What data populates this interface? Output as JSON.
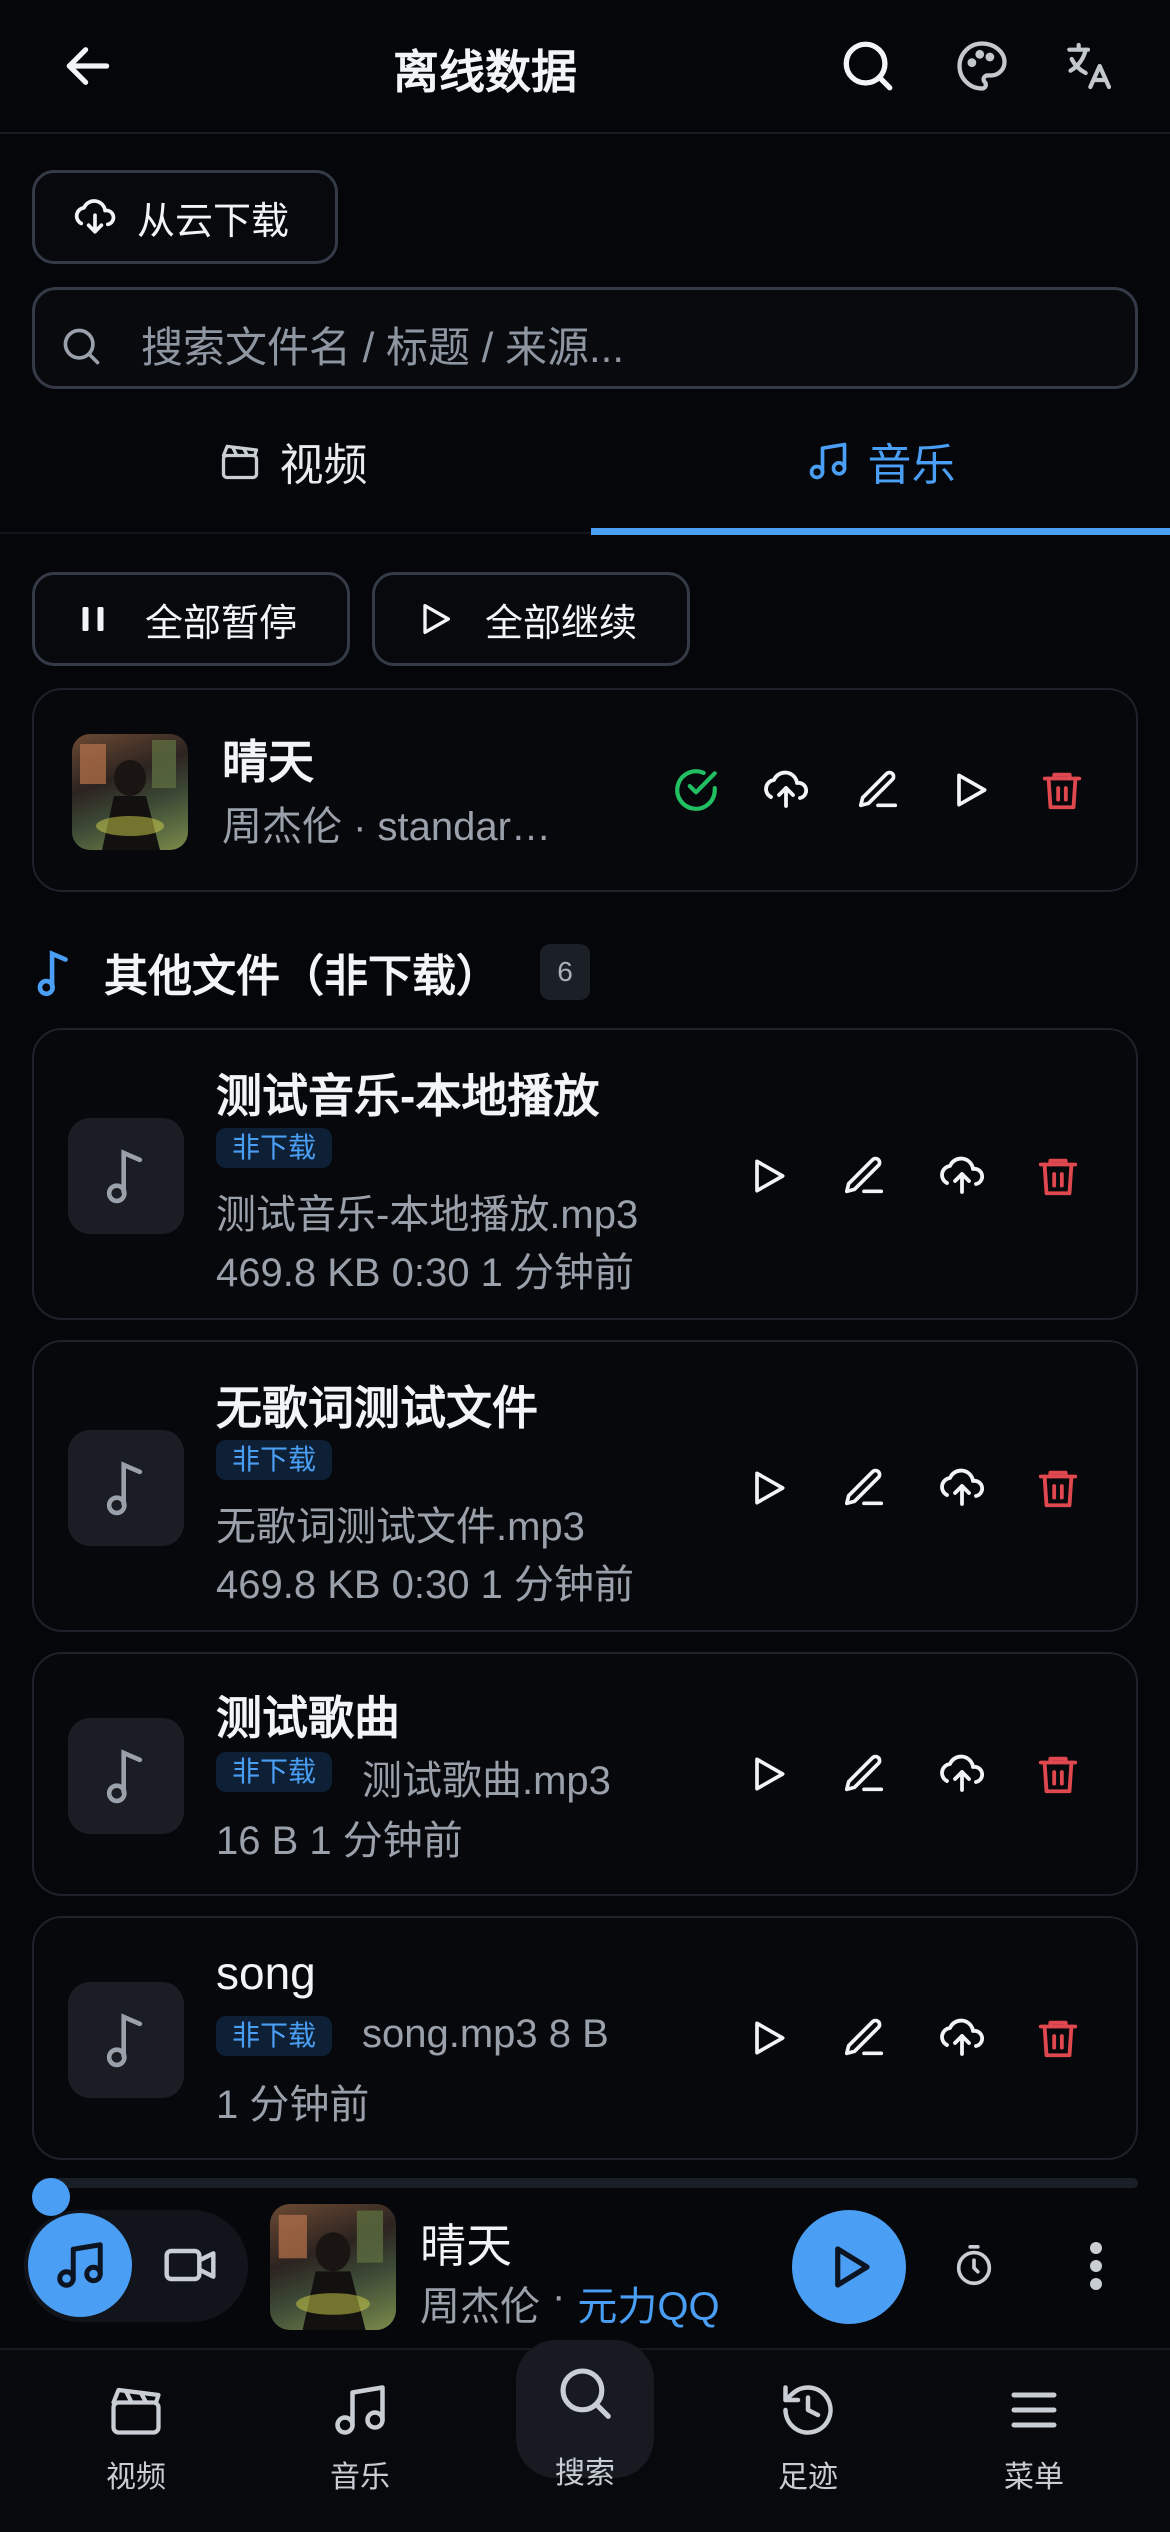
{
  "header": {
    "title": "离线数据"
  },
  "toolbar": {
    "cloud_download": "从云下载"
  },
  "search": {
    "placeholder": "搜索文件名 / 标题 / 来源..."
  },
  "tabs": [
    {
      "label": "视频",
      "active": false
    },
    {
      "label": "音乐",
      "active": true
    }
  ],
  "bulk": {
    "pause_all": "全部暂停",
    "resume_all": "全部继续"
  },
  "download_item": {
    "title": "晴天",
    "subtitle": "周杰伦 · standar…",
    "status": "completed"
  },
  "other_section": {
    "title": "其他文件（非下载）",
    "count": "6"
  },
  "other_files": [
    {
      "title": "测试音乐-本地播放",
      "badge": "非下载",
      "filename": "测试音乐-本地播放.mp3",
      "meta": "469.8 KB  0:30  1 分钟前"
    },
    {
      "title": "无歌词测试文件",
      "badge": "非下载",
      "filename": "无歌词测试文件.mp3",
      "meta": "469.8 KB  0:30  1 分钟前"
    },
    {
      "title": "测试歌曲",
      "badge": "非下载",
      "filename": "测试歌曲.mp3",
      "meta": "16 B  1 分钟前"
    },
    {
      "title": "song",
      "badge": "非下载",
      "filename": "song.mp3  8 B",
      "meta": "1 分钟前"
    }
  ],
  "player": {
    "title": "晴天",
    "artist": "周杰伦",
    "separator": "·",
    "source": "元力QQ"
  },
  "bottom_nav": [
    {
      "label": "视频",
      "icon": "clapperboard-icon"
    },
    {
      "label": "音乐",
      "icon": "music-note-icon"
    },
    {
      "label": "搜索",
      "icon": "search-icon"
    },
    {
      "label": "足迹",
      "icon": "history-icon"
    },
    {
      "label": "菜单",
      "icon": "menu-icon"
    }
  ],
  "colors": {
    "accent": "#4a9ff5",
    "danger": "#e0484f",
    "success": "#22c063",
    "background": "#04060a"
  }
}
